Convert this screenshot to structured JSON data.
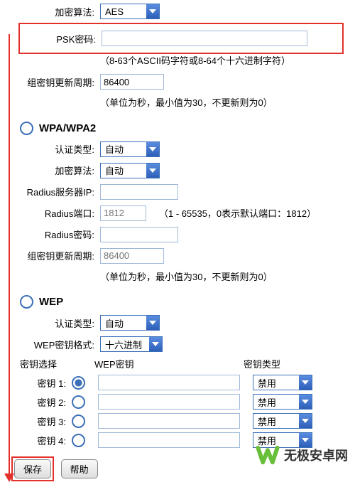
{
  "top": {
    "enc_algo_label": "加密算法:",
    "enc_algo": "AES",
    "psk_label": "PSK密码:",
    "psk_value": "",
    "psk_hint": "（8-63个ASCII码字符或8-64个十六进制字符）",
    "group_rekey_label": "组密钥更新周期:",
    "group_rekey_value": "86400",
    "group_hint": "（单位为秒，最小值为30，不更新则为0）"
  },
  "wpa": {
    "title": "WPA/WPA2",
    "auth_label": "认证类型:",
    "auth": "自动",
    "enc_label": "加密算法:",
    "enc": "自动",
    "radius_ip_label": "Radius服务器IP:",
    "radius_ip": "",
    "radius_port_label": "Radius端口:",
    "radius_port_placeholder": "1812",
    "radius_port_hint": "（1 - 65535，0表示默认端口：1812）",
    "radius_pw_label": "Radius密码:",
    "radius_pw": "",
    "group_label": "组密钥更新周期:",
    "group_placeholder": "86400",
    "group_hint": "（单位为秒，最小值为30，不更新则为0）"
  },
  "wep": {
    "title": "WEP",
    "auth_label": "认证类型:",
    "auth": "自动",
    "fmt_label": "WEP密钥格式:",
    "fmt": "十六进制",
    "head_select": "密钥选择",
    "head_key": "WEP密钥",
    "head_type": "密钥类型",
    "key1_label": "密钥 1:",
    "key2_label": "密钥 2:",
    "key3_label": "密钥 3:",
    "key4_label": "密钥 4:",
    "disable": "禁用"
  },
  "buttons": {
    "save": "保存",
    "help": "帮助"
  },
  "watermark": "无极安卓网"
}
